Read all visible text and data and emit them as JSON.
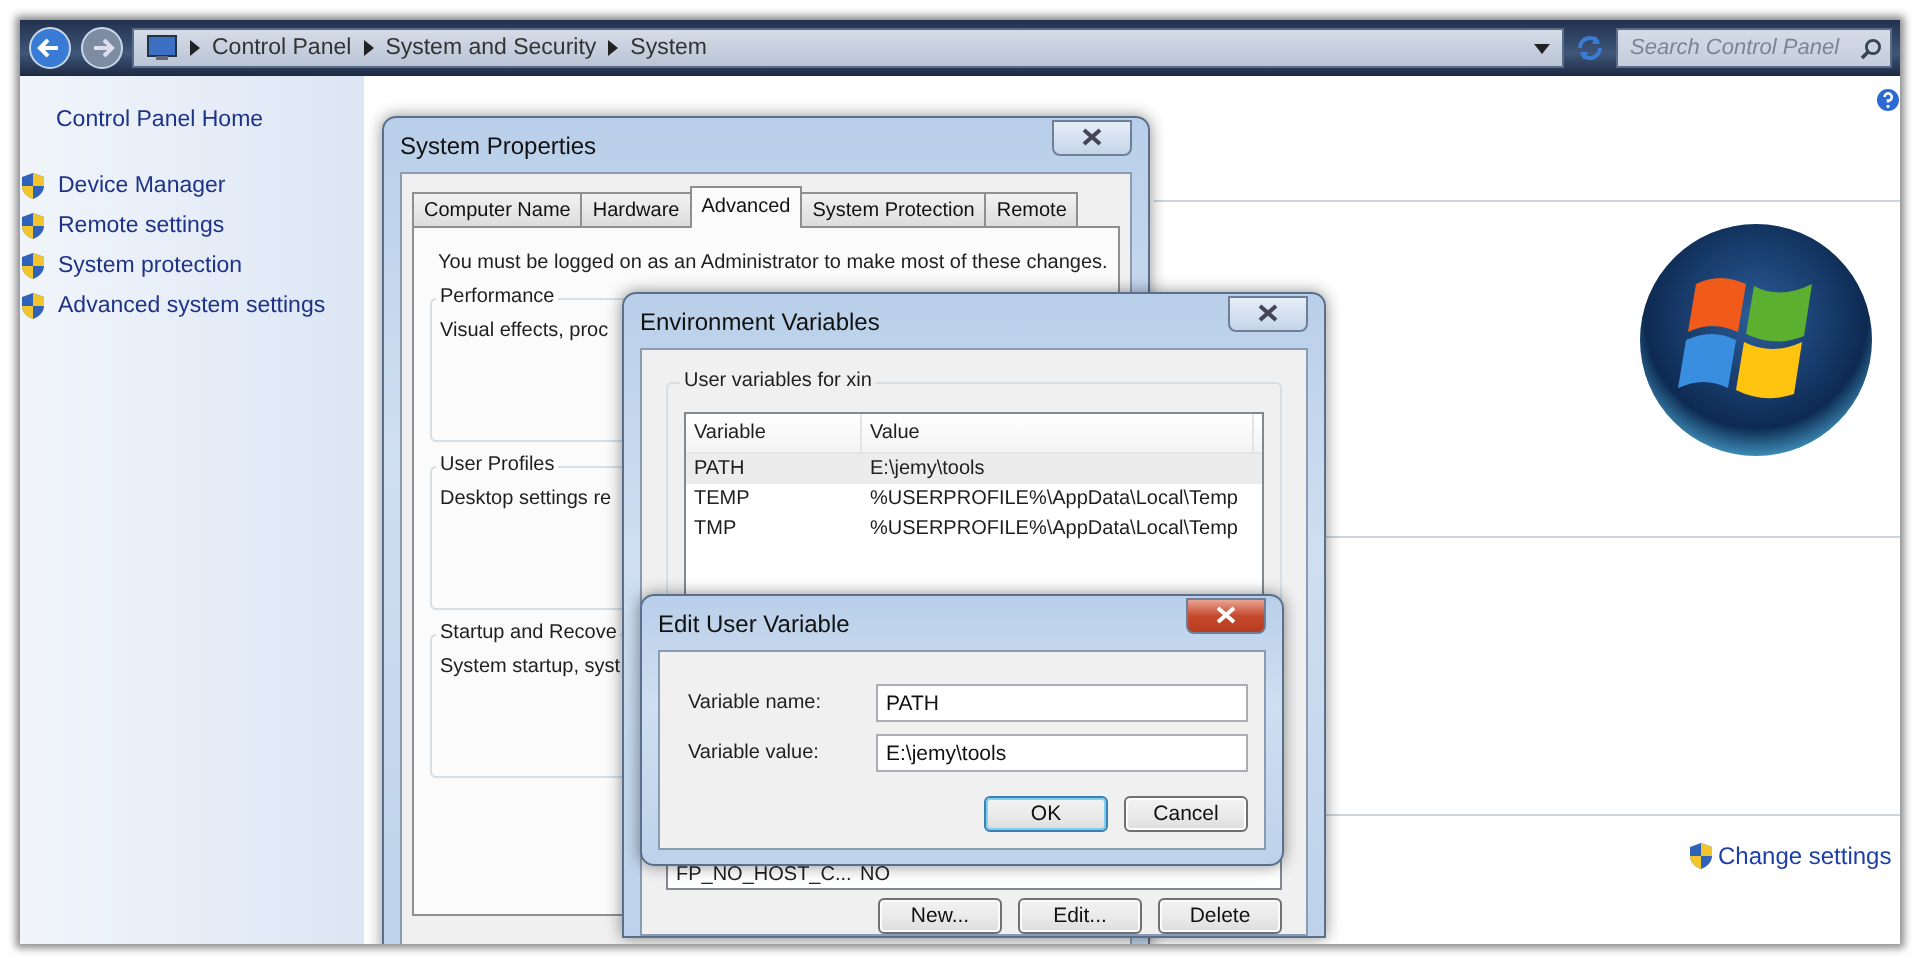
{
  "address_bar": {
    "breadcrumbs": [
      "Control Panel",
      "System and Security",
      "System"
    ],
    "search": {
      "placeholder": "Search Control Panel"
    }
  },
  "sidebar": {
    "home": "Control Panel Home",
    "items": [
      {
        "label": "Device Manager"
      },
      {
        "label": "Remote settings"
      },
      {
        "label": "System protection"
      },
      {
        "label": "Advanced system settings"
      }
    ]
  },
  "change_settings": "Change settings",
  "system_properties": {
    "title": "System Properties",
    "tabs": [
      {
        "label": "Computer Name",
        "selected": false
      },
      {
        "label": "Hardware",
        "selected": false
      },
      {
        "label": "Advanced",
        "selected": true
      },
      {
        "label": "System Protection",
        "selected": false
      },
      {
        "label": "Remote",
        "selected": false
      }
    ],
    "notice": "You must be logged on as an Administrator to make most of these changes.",
    "groups": [
      {
        "title": "Performance",
        "text": "Visual effects, proc"
      },
      {
        "title": "User Profiles",
        "text": "Desktop settings re"
      },
      {
        "title": "Startup and Recove",
        "text": "System startup, syst"
      }
    ]
  },
  "environment_variables": {
    "title": "Environment Variables",
    "user_group": "User variables for xin",
    "columns": [
      "Variable",
      "Value"
    ],
    "rows": [
      {
        "variable": "PATH",
        "value": "E:\\jemy\\tools",
        "selected": true
      },
      {
        "variable": "TEMP",
        "value": "%USERPROFILE%\\AppData\\Local\\Temp",
        "selected": false
      },
      {
        "variable": "TMP",
        "value": "%USERPROFILE%\\AppData\\Local\\Temp",
        "selected": false
      }
    ],
    "system_row": {
      "variable": "FP_NO_HOST_C...",
      "value": "NO"
    },
    "buttons": [
      "New...",
      "Edit...",
      "Delete"
    ]
  },
  "edit_dialog": {
    "title": "Edit User Variable",
    "fields": [
      {
        "label": "Variable name:",
        "value": "PATH"
      },
      {
        "label": "Variable value:",
        "value": "E:\\jemy\\tools"
      }
    ],
    "buttons": [
      {
        "label": "OK",
        "default": true
      },
      {
        "label": "Cancel",
        "default": false
      }
    ]
  }
}
